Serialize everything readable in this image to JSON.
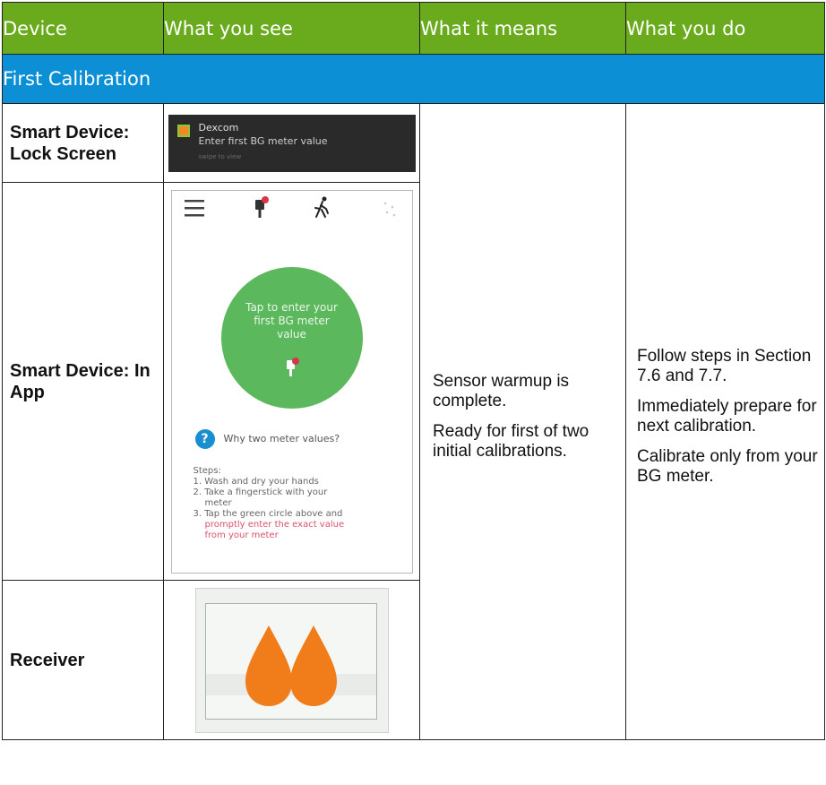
{
  "header": {
    "col1": "Device",
    "col2": "What you see",
    "col3": "What it means",
    "col4": "What you do"
  },
  "section": {
    "title": "First Calibration"
  },
  "rows": {
    "lock_label": "Smart Device: Lock Screen",
    "app_label": "Smart Device: In App",
    "receiver_label": "Receiver"
  },
  "lock_screen": {
    "app_name": "Dexcom",
    "message": "Enter first BG meter value",
    "hint": "swipe to view"
  },
  "app_screen": {
    "circle_text": "Tap to enter your first BG meter value",
    "question": "Why two meter values?",
    "steps_title": "Steps:",
    "step1": "1. Wash and dry your hands",
    "step2a": "2. Take a fingerstick with your",
    "step2b": "meter",
    "step3a": "3. Tap the green circle above and",
    "step3b": "promptly enter the exact value",
    "step3c": "from your meter",
    "icons": [
      "menu-icon",
      "meter-alert-icon",
      "activity-icon",
      "dots-icon"
    ]
  },
  "meaning": {
    "p1": "Sensor warmup is complete.",
    "p2": "Ready for first of two initial calibrations."
  },
  "todo": {
    "p1": "Follow steps in Section 7.6 and 7.7.",
    "p2": "Immediately prepare for next calibration.",
    "p3": "Calibrate only from your BG meter."
  },
  "colors": {
    "header_green": "#6aab1e",
    "section_blue": "#0d8fd6",
    "circle_green": "#5cb85c",
    "drop_orange": "#f07d1a",
    "warning_pink": "#d9536f"
  }
}
